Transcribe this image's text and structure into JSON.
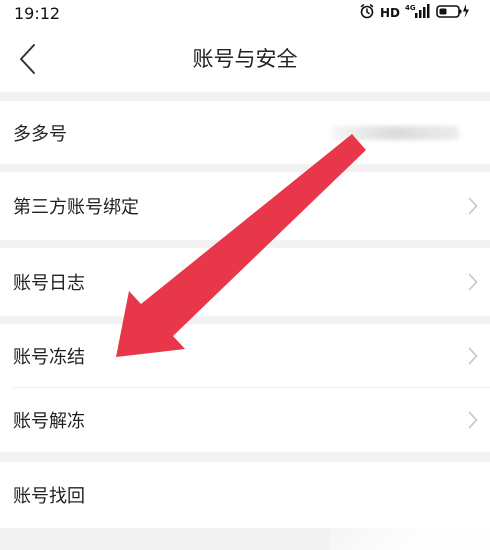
{
  "status_bar": {
    "time": "19:12",
    "hd_label": "HD",
    "network_label": "4G",
    "icons": [
      "alarm-icon",
      "signal-icon",
      "battery-charging-icon"
    ]
  },
  "header": {
    "title": "账号与安全",
    "back_icon": "chevron-left-icon"
  },
  "rows": {
    "duoduo_id": {
      "label": "多多号"
    },
    "third_party_binding": {
      "label": "第三方账号绑定"
    },
    "account_log": {
      "label": "账号日志"
    },
    "account_freeze": {
      "label": "账号冻结"
    },
    "account_unfreeze": {
      "label": "账号解冻"
    },
    "account_recovery": {
      "label": "账号找回"
    }
  },
  "annotation": {
    "arrow_color": "#e8374a",
    "points_to": "account_freeze"
  },
  "colors": {
    "background": "#f2f2f2",
    "card": "#ffffff",
    "text": "#222222",
    "chevron": "#c4c4c4"
  }
}
